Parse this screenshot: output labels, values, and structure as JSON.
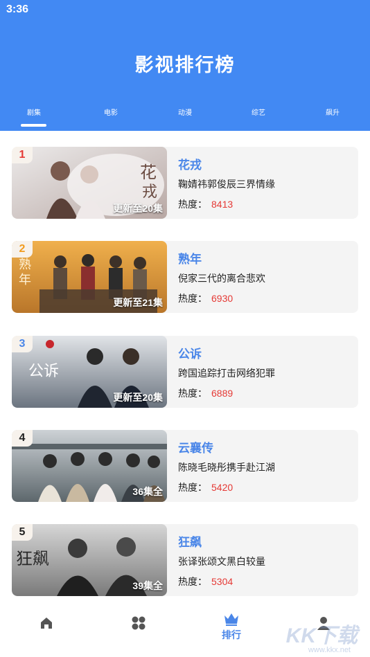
{
  "status_bar": {
    "time": "3:36"
  },
  "header": {
    "title": "影视排行榜"
  },
  "tabs": [
    {
      "label": "剧集",
      "active": true
    },
    {
      "label": "电影",
      "active": false
    },
    {
      "label": "动漫",
      "active": false
    },
    {
      "label": "综艺",
      "active": false
    },
    {
      "label": "飙升",
      "active": false
    }
  ],
  "heat_label": "热度：",
  "shows": [
    {
      "rank": "1",
      "rank_color": "#e53935",
      "title": "花戎",
      "desc": "鞠婧祎郭俊辰三界情缘",
      "heat": "8413",
      "episodes": "更新至20集",
      "poster_palette": [
        "#e9e6e6",
        "#b9a9a6",
        "#7a5a4e"
      ]
    },
    {
      "rank": "2",
      "rank_color": "#f29c1f",
      "title": "熟年",
      "desc": "倪家三代的离合悲欢",
      "heat": "6930",
      "episodes": "更新至21集",
      "poster_palette": [
        "#e5a240",
        "#b9762a",
        "#3d3128"
      ]
    },
    {
      "rank": "3",
      "rank_color": "#4a86e8",
      "title": "公诉",
      "desc": "跨国追踪打击网络犯罪",
      "heat": "6889",
      "episodes": "更新至20集",
      "poster_palette": [
        "#d9dde2",
        "#8d96a1",
        "#1f2530"
      ]
    },
    {
      "rank": "4",
      "rank_color": "#222222",
      "title": "云襄传",
      "desc": "陈晓毛晓彤携手赴江湖",
      "heat": "5420",
      "episodes": "36集全",
      "poster_palette": [
        "#c7ccd0",
        "#7d8a8f",
        "#3b4348"
      ]
    },
    {
      "rank": "5",
      "rank_color": "#222222",
      "title": "狂飙",
      "desc": "张译张颂文黑白较量",
      "heat": "5304",
      "episodes": "39集全",
      "poster_palette": [
        "#cfcfcf",
        "#8a8a8a",
        "#2a2a2a"
      ]
    }
  ],
  "bottom_nav": [
    {
      "icon": "home-icon",
      "label": ""
    },
    {
      "icon": "grid-icon",
      "label": ""
    },
    {
      "icon": "crown-icon",
      "label": "排行",
      "active": true
    },
    {
      "icon": "profile-icon",
      "label": ""
    }
  ],
  "watermark": {
    "brand": "KK下载",
    "url": "www.kkx.net"
  }
}
